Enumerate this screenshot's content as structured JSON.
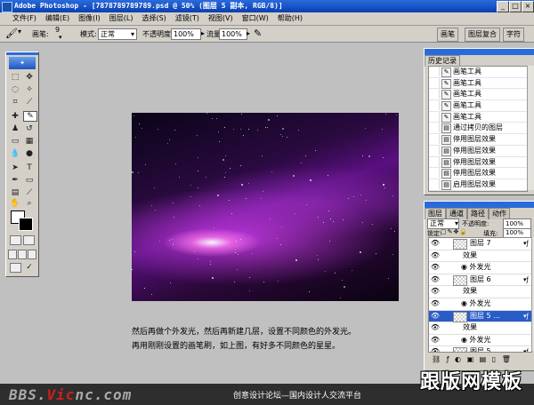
{
  "window": {
    "title": "Adobe Photoshop - [7878789789789.psd @ 50% (图层 5 副本, RGB/8)]",
    "controls": [
      "_",
      "□",
      "×"
    ]
  },
  "menubar": {
    "items": [
      "文件(F)",
      "编辑(E)",
      "图像(I)",
      "图层(L)",
      "选择(S)",
      "滤镜(T)",
      "视图(V)",
      "窗口(W)",
      "帮助(H)"
    ]
  },
  "options": {
    "brush_label": "画笔:",
    "brush_size": "9",
    "mode_label": "模式:",
    "mode_value": "正常",
    "opacity_label": "不透明度:",
    "opacity_value": "100%",
    "flow_label": "流量:",
    "flow_value": "100%",
    "palette_tabs": [
      "画笔",
      "图层复合",
      "字符"
    ]
  },
  "history": {
    "title": "历史记录",
    "items": [
      {
        "label": "画笔工具",
        "icon": "brush-icon",
        "selected": false
      },
      {
        "label": "画笔工具",
        "icon": "brush-icon",
        "selected": false
      },
      {
        "label": "画笔工具",
        "icon": "brush-icon",
        "selected": false
      },
      {
        "label": "画笔工具",
        "icon": "brush-icon",
        "selected": false
      },
      {
        "label": "画笔工具",
        "icon": "brush-icon",
        "selected": false
      },
      {
        "label": "通过拷贝的图层",
        "icon": "layer-icon",
        "selected": false
      },
      {
        "label": "停用图层效果",
        "icon": "layer-icon",
        "selected": false
      },
      {
        "label": "停用图层效果",
        "icon": "layer-icon",
        "selected": false
      },
      {
        "label": "停用图层效果",
        "icon": "layer-icon",
        "selected": false
      },
      {
        "label": "停用图层效果",
        "icon": "layer-icon",
        "selected": false
      },
      {
        "label": "启用图层效果",
        "icon": "layer-icon",
        "selected": false
      },
      {
        "label": "启用图层效果",
        "icon": "layer-icon",
        "selected": false
      },
      {
        "label": "启用图层效果",
        "icon": "layer-icon",
        "selected": true
      }
    ]
  },
  "layers": {
    "tabs": [
      "图层",
      "通道",
      "路径",
      "动作"
    ],
    "blend_mode": "正常",
    "opacity_label": "不透明度:",
    "opacity_value": "100%",
    "lock_label": "锁定:",
    "fill_label": "填充:",
    "fill_value": "100%",
    "rows": [
      {
        "label": "图层 7",
        "kind": "layer",
        "selected": false
      },
      {
        "label": "效果",
        "kind": "effects",
        "selected": false
      },
      {
        "label": "外发光",
        "kind": "effect",
        "selected": false
      },
      {
        "label": "图层 6",
        "kind": "layer",
        "selected": false
      },
      {
        "label": "效果",
        "kind": "effects",
        "selected": false
      },
      {
        "label": "外发光",
        "kind": "effect",
        "selected": false
      },
      {
        "label": "图层 5 ...",
        "kind": "layer",
        "selected": true
      },
      {
        "label": "效果",
        "kind": "effects",
        "selected": false
      },
      {
        "label": "外发光",
        "kind": "effect",
        "selected": false
      },
      {
        "label": "图层 5",
        "kind": "layer",
        "selected": false
      }
    ]
  },
  "caption": {
    "line1": "然后再做个外发光，然后再新建几层，设置不同颜色的外发光。",
    "line2": "再用刚刚设置的画笔刷，如上图，有好多不同颜色的星星。"
  },
  "banner": {
    "site_prefix": "BBS.",
    "site_accent": "Vic",
    "site_suffix": "nc.com",
    "slogan": "创意设计论坛—国内设计人交流平台",
    "brand": "跟版网模板"
  },
  "colors": {
    "titlebar": "#0a3fb0",
    "ui_gray": "#d4d0c8",
    "selection": "#2a5cc8",
    "nebula_core": "#c83ce6"
  }
}
